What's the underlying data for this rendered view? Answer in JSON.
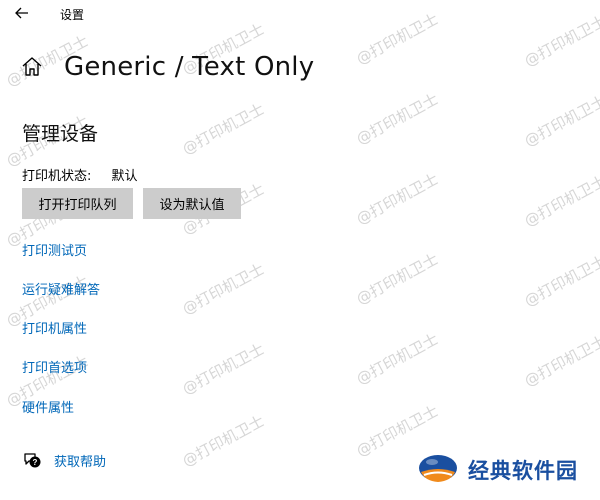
{
  "window": {
    "title": "设置"
  },
  "header": {
    "title": "Generic / Text Only"
  },
  "section": {
    "title": "管理设备"
  },
  "status": {
    "label": "打印机状态:",
    "value": "默认"
  },
  "buttons": {
    "open_queue": "打开打印队列",
    "set_default": "设为默认值"
  },
  "links": [
    {
      "label": "打印测试页"
    },
    {
      "label": "运行疑难解答"
    },
    {
      "label": "打印机属性"
    },
    {
      "label": "打印首选项"
    },
    {
      "label": "硬件属性"
    }
  ],
  "help": {
    "label": "获取帮助"
  },
  "watermark": {
    "text": "@打印机卫士"
  },
  "logo": {
    "text": "经典软件园"
  },
  "colors": {
    "link": "#0067b8",
    "button_bg": "#cccccc",
    "watermark": "#d6d6d6",
    "logo_blue": "#1a4fa0",
    "logo_orange": "#f08a1c"
  },
  "icons": {
    "back": "back-arrow-icon",
    "home": "home-icon",
    "help": "help-chat-icon",
    "logo": "logo-mark-icon"
  }
}
